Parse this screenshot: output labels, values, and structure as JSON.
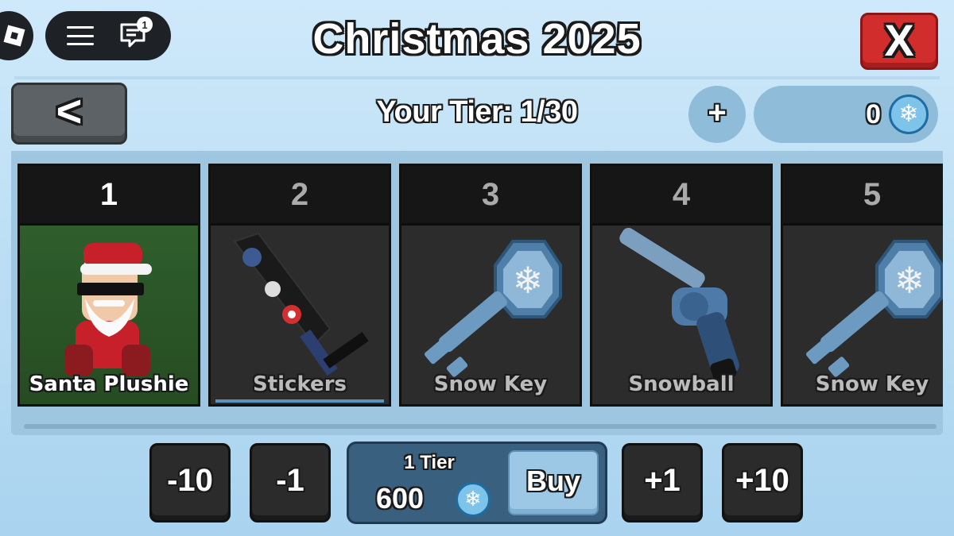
{
  "header": {
    "title": "Christmas 2025",
    "close_label": "X",
    "back_label": "<",
    "chat_badge_count": "1"
  },
  "tier_bar": {
    "tier_text": "Your Tier: 1/30",
    "plus_label": "+",
    "currency_amount": "0",
    "currency_icon": "snowflake-icon"
  },
  "rewards": [
    {
      "tier": "1",
      "name": "Santa Plushie",
      "state": "unlocked"
    },
    {
      "tier": "2",
      "name": "Stickers",
      "state": "locked"
    },
    {
      "tier": "3",
      "name": "Snow Key",
      "state": "locked"
    },
    {
      "tier": "4",
      "name": "Snowball",
      "state": "locked"
    },
    {
      "tier": "5",
      "name": "Snow Key",
      "state": "locked"
    }
  ],
  "purchase": {
    "minus10": "-10",
    "minus1": "-1",
    "tier_count": "1 Tier",
    "price": "600",
    "buy_label": "Buy",
    "plus1": "+1",
    "plus10": "+10"
  },
  "colors": {
    "close_red": "#d22d2d",
    "buy_panel": "#3a6080",
    "unlocked_green": "#2f5e2c",
    "background": "#bfe0f5"
  }
}
